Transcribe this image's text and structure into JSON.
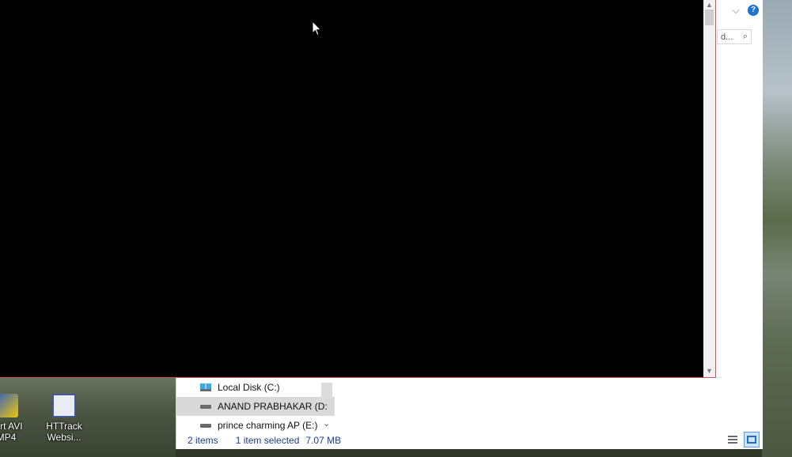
{
  "desktop": {
    "icons": [
      {
        "label_line1": "vert AVI",
        "label_line2": "MP4"
      },
      {
        "label_line1": "HTTrack",
        "label_line2": "Websi..."
      }
    ]
  },
  "explorer": {
    "search_partial": "d...",
    "nav_items": [
      {
        "label": "Local Disk (C:)",
        "icon": "windows-drive-icon"
      },
      {
        "label": "ANAND PRABHAKAR (D:",
        "icon": "usb-drive-icon"
      },
      {
        "label": "prince charming AP (E:)",
        "icon": "usb-drive-icon"
      }
    ],
    "status": {
      "items_count": "2 items",
      "selection": "1 item selected",
      "size": "7.07 MB"
    }
  },
  "icons": {
    "help": "?",
    "chevron": "⌵",
    "scroll_up": "▲",
    "scroll_down": "▼",
    "nav_down": "⌄",
    "search": "⌕"
  }
}
